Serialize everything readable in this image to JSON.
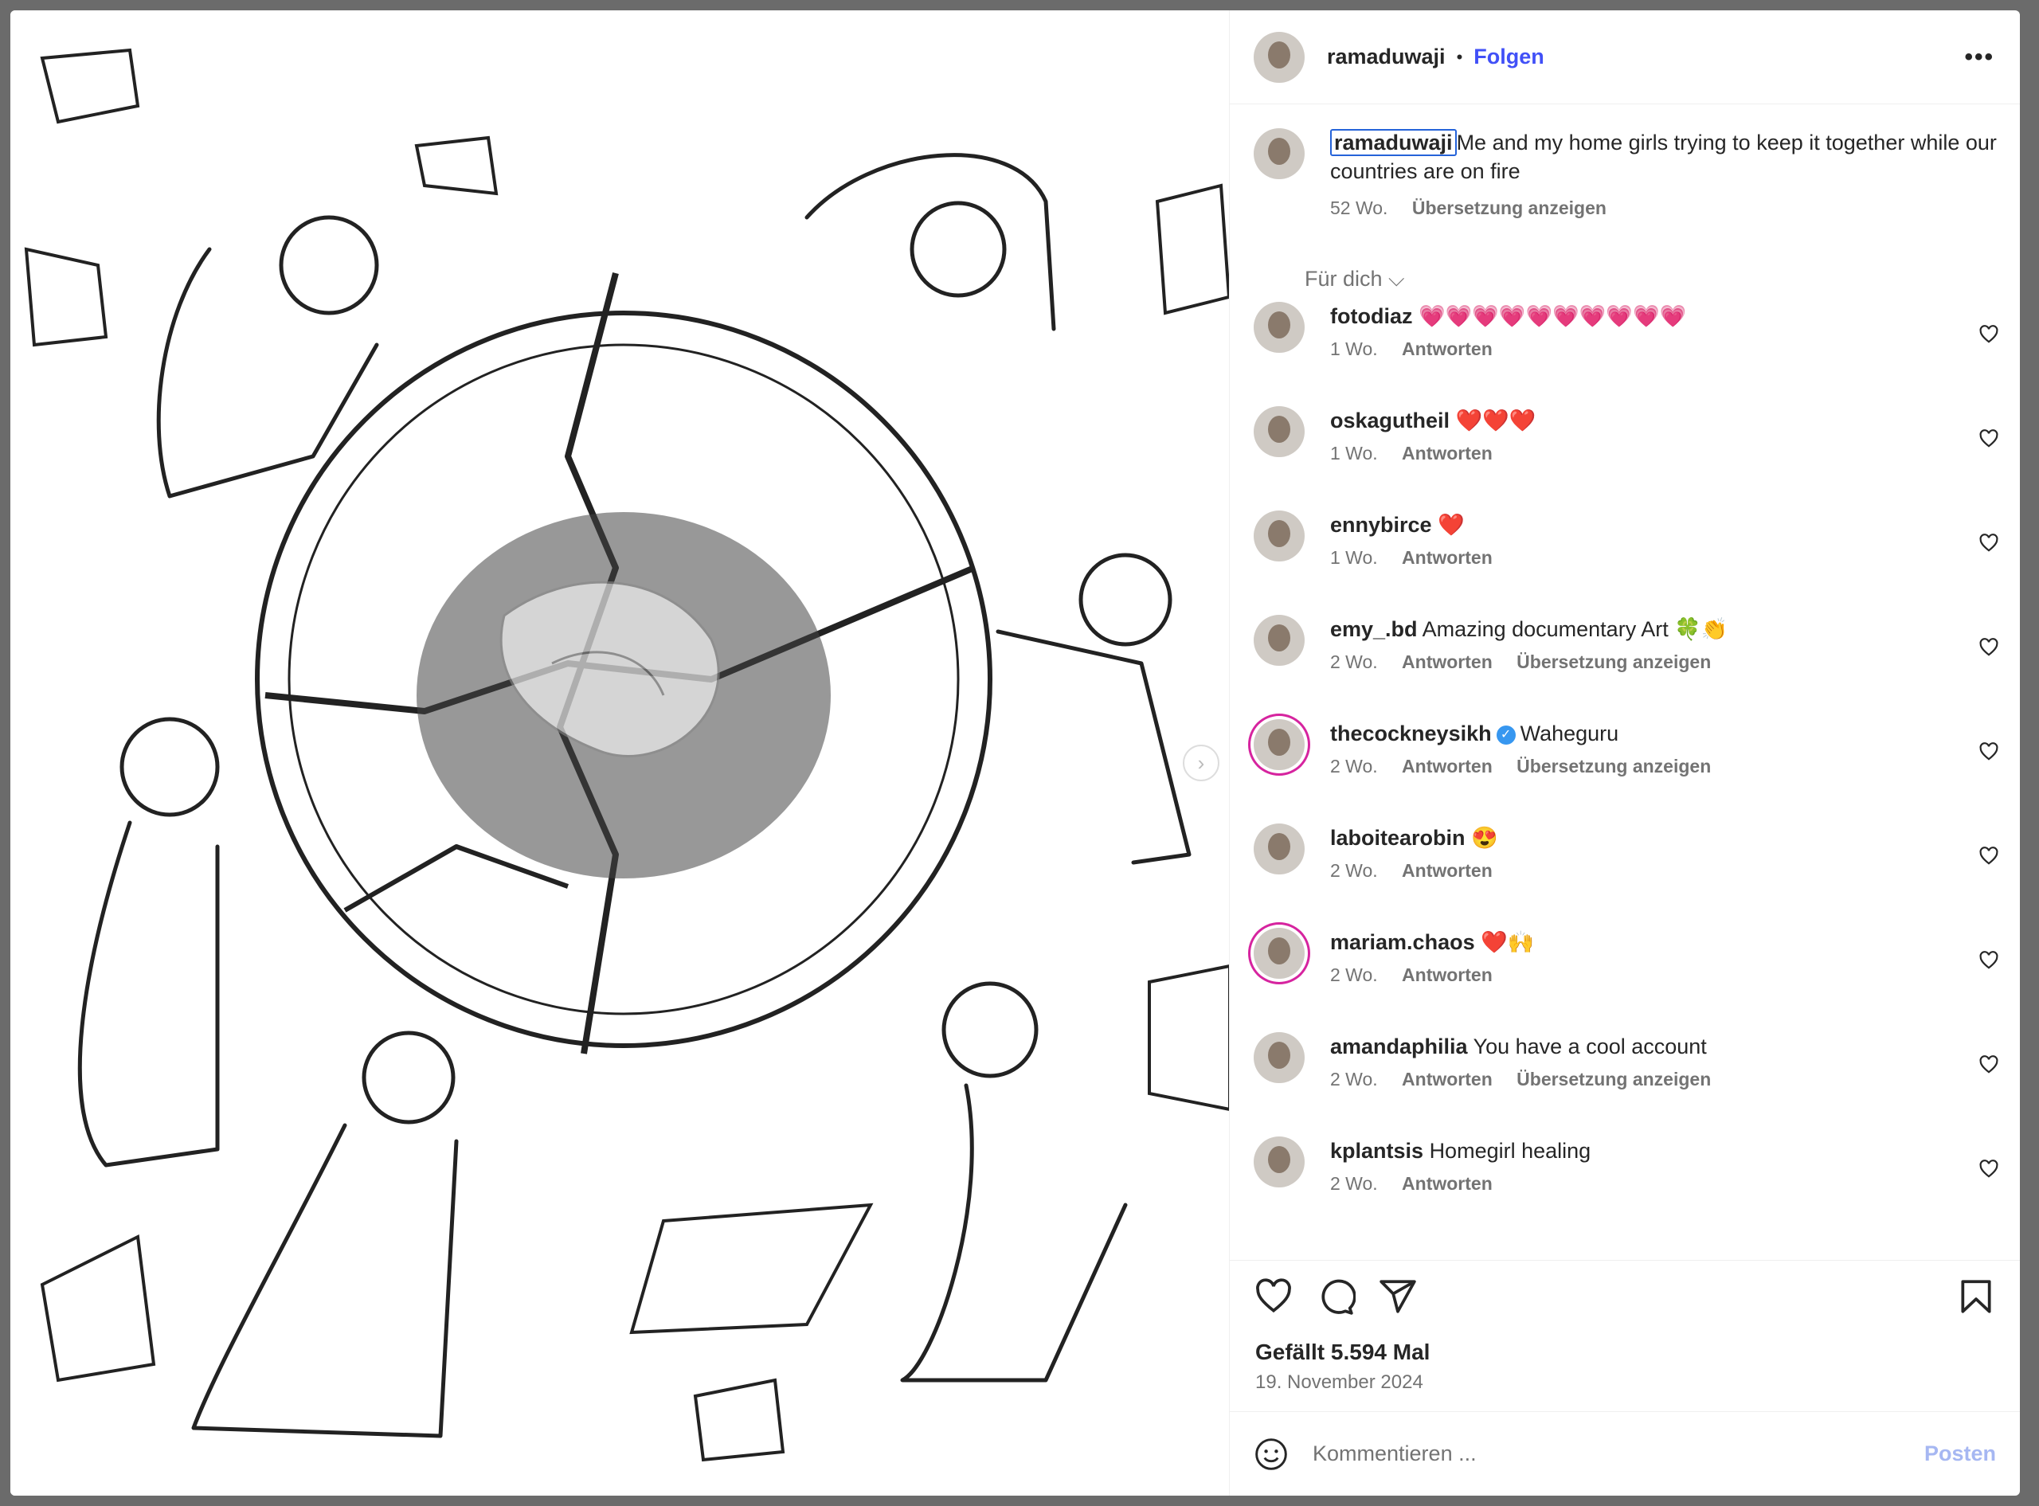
{
  "header": {
    "username": "ramaduwaji",
    "separator": "•",
    "follow_label": "Folgen",
    "more_label": "•••"
  },
  "caption": {
    "username": "ramaduwaji",
    "text": "Me and my home girls trying to keep it together while our countries are on fire",
    "time": "52 Wo.",
    "translate_label": "Übersetzung anzeigen"
  },
  "filter_label": "Für dich ⌵",
  "comments": [
    {
      "username": "fotodiaz",
      "text": "💗💗💗💗💗💗💗💗💗💗",
      "time": "1 Wo.",
      "reply": "Antworten",
      "translate": ""
    },
    {
      "username": "oskagutheil",
      "text": "❤️❤️❤️",
      "time": "1 Wo.",
      "reply": "Antworten",
      "translate": ""
    },
    {
      "username": "ennybirce",
      "text": "❤️",
      "time": "1 Wo.",
      "reply": "Antworten",
      "translate": ""
    },
    {
      "username": "emy_.bd",
      "text": "Amazing documentary Art 🍀👏",
      "time": "2 Wo.",
      "reply": "Antworten",
      "translate": "Übersetzung anzeigen"
    },
    {
      "username": "thecockneysikh",
      "text": "Waheguru",
      "time": "2 Wo.",
      "reply": "Antworten",
      "translate": "Übersetzung anzeigen"
    },
    {
      "username": "laboitearobin",
      "text": "😍",
      "time": "2 Wo.",
      "reply": "Antworten",
      "translate": ""
    },
    {
      "username": "mariam.chaos",
      "text": "❤️🙌",
      "time": "2 Wo.",
      "reply": "Antworten",
      "translate": ""
    },
    {
      "username": "amandaphilia",
      "text": "You have a cool account",
      "time": "2 Wo.",
      "reply": "Antworten",
      "translate": "Übersetzung anzeigen"
    },
    {
      "username": "kplantsis",
      "text": "Homegirl healing",
      "time": "2 Wo.",
      "reply": "Antworten",
      "translate": ""
    }
  ],
  "likes": "Gefällt 5.594 Mal",
  "date": "19. November 2024",
  "compose": {
    "placeholder": "Kommentieren ...",
    "post_label": "Posten"
  },
  "colors": {
    "follow": "#4150f7",
    "verified": "#3797f0",
    "story_ring": "#d6249f",
    "post_disabled": "#a6b7f2"
  },
  "icons": [
    "more-icon",
    "heart-icon",
    "comment-icon",
    "share-icon",
    "bookmark-icon",
    "emoji-icon",
    "verified-badge-icon",
    "chevron-right-icon"
  ]
}
